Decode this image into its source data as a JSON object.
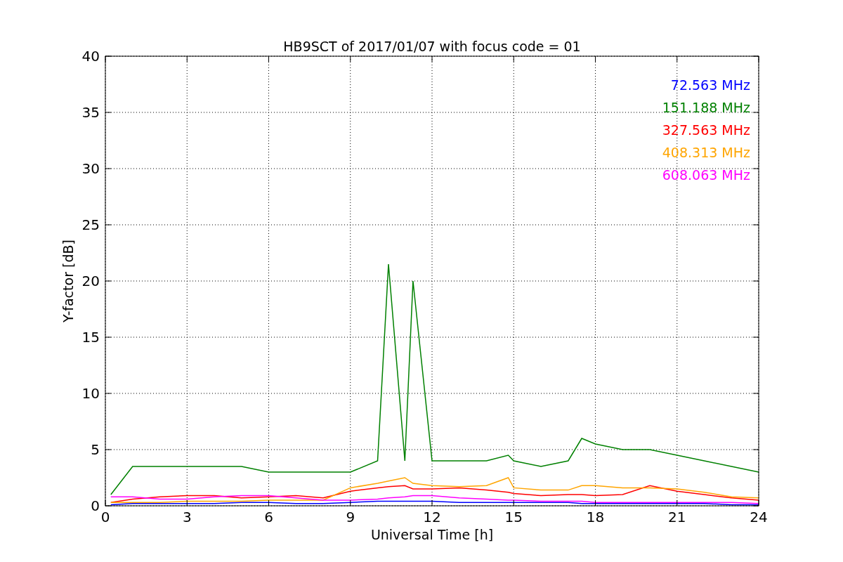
{
  "figure": {
    "chart_data": {
      "type": "line",
      "title": "HB9SCT of 2017/01/07 with focus code = 01",
      "xlabel": "Universal Time [h]",
      "ylabel": "Y-factor [dB]",
      "x": [
        0.2,
        1,
        2,
        3,
        4,
        5,
        6,
        7,
        8,
        9,
        10,
        10.4,
        11,
        11.3,
        12,
        13,
        14,
        14.8,
        15,
        16,
        17,
        17.5,
        18,
        19,
        20,
        21,
        22,
        23,
        24
      ],
      "xlim": [
        0,
        24
      ],
      "ylim": [
        0,
        40
      ],
      "grid": true,
      "xticks": [
        0,
        3,
        6,
        9,
        12,
        15,
        18,
        21,
        24
      ],
      "yticks": [
        0,
        5,
        10,
        15,
        20,
        25,
        30,
        35,
        40
      ],
      "series": [
        {
          "name": "72.563 MHz",
          "color": "#0000ff",
          "values": [
            0.1,
            0.2,
            0.2,
            0.2,
            0.2,
            0.3,
            0.3,
            0.2,
            0.2,
            0.3,
            0.4,
            0.4,
            0.4,
            0.4,
            0.4,
            0.3,
            0.3,
            0.3,
            0.3,
            0.3,
            0.3,
            0.2,
            0.2,
            0.2,
            0.2,
            0.2,
            0.2,
            0.1,
            0.1
          ]
        },
        {
          "name": "151.188 MHz",
          "color": "#008000",
          "values": [
            1,
            3.5,
            3.5,
            3.5,
            3.5,
            3.5,
            3,
            3,
            3,
            3,
            4,
            21.5,
            4,
            20,
            4,
            4,
            4,
            4.5,
            4,
            3.5,
            4,
            6,
            5.5,
            5,
            5,
            4.5,
            4,
            3.5,
            3
          ]
        },
        {
          "name": "327.563 MHz",
          "color": "#ff0000",
          "values": [
            0.3,
            0.6,
            0.8,
            0.9,
            0.9,
            0.7,
            0.8,
            0.9,
            0.7,
            1.3,
            1.6,
            1.7,
            1.8,
            1.5,
            1.5,
            1.6,
            1.4,
            1.2,
            1.1,
            0.9,
            1,
            1,
            0.9,
            1,
            1.8,
            1.3,
            1,
            0.7,
            0.5
          ]
        },
        {
          "name": "408.313 MHz",
          "color": "#ffa500",
          "values": [
            0.3,
            0.3,
            0.3,
            0.4,
            0.4,
            0.4,
            0.5,
            0.5,
            0.5,
            1.6,
            2,
            2.2,
            2.5,
            2,
            1.8,
            1.7,
            1.8,
            2.5,
            1.6,
            1.4,
            1.4,
            1.8,
            1.8,
            1.6,
            1.6,
            1.5,
            1.2,
            0.8,
            0.7
          ]
        },
        {
          "name": "608.063 MHz",
          "color": "#ff00ff",
          "values": [
            0.8,
            0.8,
            0.6,
            0.6,
            0.8,
            0.9,
            0.9,
            0.7,
            0.5,
            0.5,
            0.6,
            0.7,
            0.8,
            0.9,
            0.9,
            0.7,
            0.6,
            0.5,
            0.5,
            0.4,
            0.4,
            0.4,
            0.3,
            0.3,
            0.3,
            0.3,
            0.3,
            0.3,
            0.2
          ]
        }
      ]
    }
  }
}
